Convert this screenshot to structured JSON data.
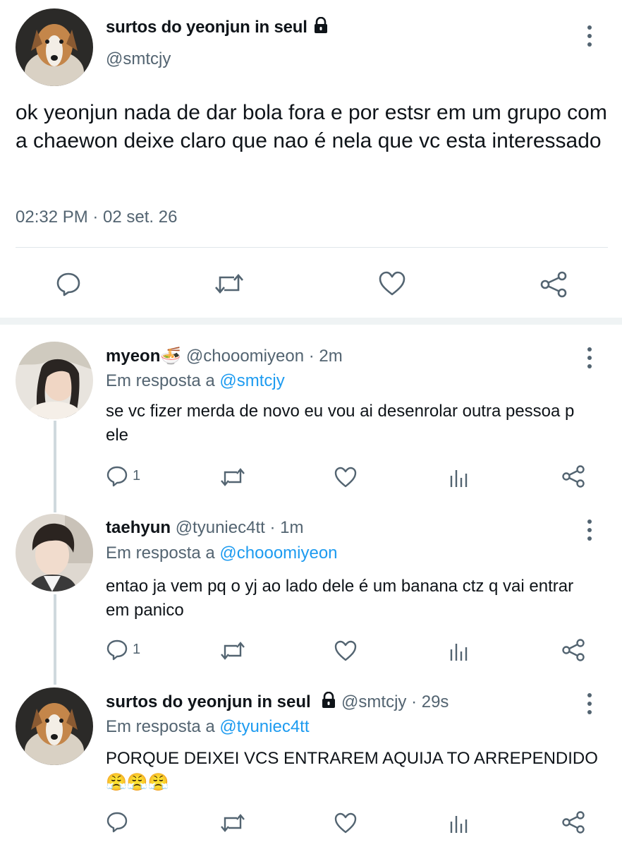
{
  "main_tweet": {
    "display_name": "surtos do yeonjun in seul",
    "handle": "@smtcjy",
    "text": "ok yeonjun nada de dar bola fora e por estsr em um grupo com a chaewon deixe claro que nao é nela que vc esta interessado",
    "timestamp": "02:32 PM · 02 set. 26",
    "icons": [
      "lock-icon",
      "more-icon",
      "reply-icon",
      "retweet-icon",
      "like-icon",
      "share-icon"
    ]
  },
  "replies": [
    {
      "display_name": "myeon🍜",
      "handle": "@chooomiyeon",
      "time": "· 2m",
      "replying_prefix": "Em resposta a ",
      "replying_to": "@smtcjy",
      "text": "se vc fizer merda de novo eu vou ai desenrolar outra pessoa p ele",
      "reply_count": "1"
    },
    {
      "display_name": "taehyun",
      "handle": "@tyuniec4tt",
      "time": "· 1m",
      "replying_prefix": "Em resposta a ",
      "replying_to": "@chooomiyeon",
      "text": "entao ja vem pq o yj ao lado dele é um banana ctz q vai entrar em panico",
      "reply_count": "1"
    },
    {
      "display_name": "surtos do yeonjun in seul",
      "handle": "@smtcjy",
      "time": "· 29s",
      "replying_prefix": "Em resposta a ",
      "replying_to": "@tyuniec4tt",
      "text": "PORQUE DEIXEI VCS ENTRAREM AQUIJA TO ARREPENDIDO 😤😤😤",
      "reply_count": ""
    }
  ],
  "colors": {
    "text_primary": "#0f1419",
    "text_secondary": "#536471",
    "link": "#1d9bf0",
    "divider": "#e1e6ea",
    "thread_line": "#cfd9de"
  }
}
